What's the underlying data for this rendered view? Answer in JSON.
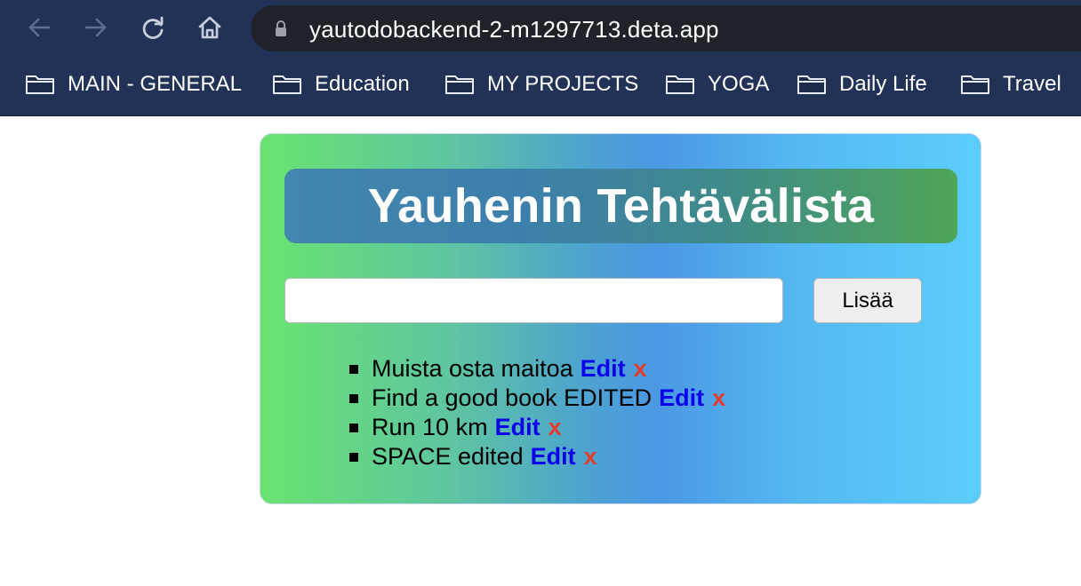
{
  "browser": {
    "url": "yautodobackend-2-m1297713.deta.app",
    "bookmarks": [
      {
        "label": "MAIN - GENERAL",
        "icon": "folder-icon"
      },
      {
        "label": "Education",
        "icon": "folder-icon"
      },
      {
        "label": "MY PROJECTS",
        "icon": "folder-icon"
      },
      {
        "label": "YOGA",
        "icon": "folder-icon"
      },
      {
        "label": "Daily Life",
        "icon": "folder-icon"
      },
      {
        "label": "Travel",
        "icon": "folder-icon"
      }
    ]
  },
  "app": {
    "title": "Yauhenin Tehtävälista",
    "input": {
      "value": "",
      "placeholder": ""
    },
    "add_button_label": "Lisää",
    "todos": [
      {
        "text": "Muista osta maitoa",
        "edit_label": "Edit",
        "delete_label": "x"
      },
      {
        "text": "Find a good book EDITED",
        "edit_label": "Edit",
        "delete_label": "x"
      },
      {
        "text": "Run 10 km",
        "edit_label": "Edit",
        "delete_label": "x"
      },
      {
        "text": "SPACE edited",
        "edit_label": "Edit",
        "delete_label": "x"
      }
    ]
  },
  "colors": {
    "chrome_bg": "#223256",
    "omnibox_bg": "#1f2229",
    "edit_link": "#0a00ea",
    "delete_link": "#e53b2a"
  }
}
